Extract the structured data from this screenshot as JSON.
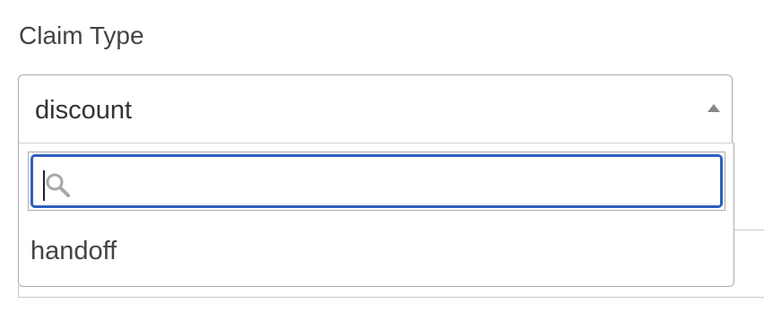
{
  "field": {
    "label": "Claim Type",
    "selected_value": "discount"
  },
  "search": {
    "value": "",
    "placeholder": ""
  },
  "options": [
    {
      "label": "handoff"
    }
  ],
  "colors": {
    "focus_border": "#2f5fbf",
    "border": "#aaaaaa",
    "text": "#333333"
  },
  "icons": {
    "search": "search-icon",
    "arrow": "triangle-up-icon"
  }
}
